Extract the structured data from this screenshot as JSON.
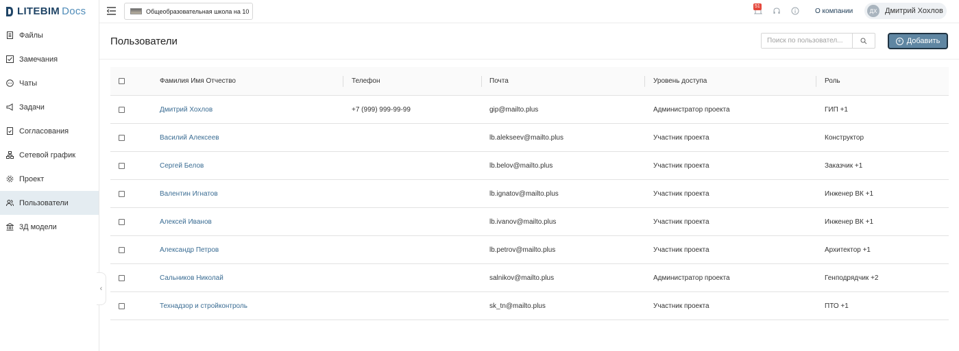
{
  "app": {
    "logo_main": "LITEBIM",
    "logo_sub": "Docs"
  },
  "sidebar": {
    "items": [
      {
        "label": "Файлы",
        "icon": "file-icon"
      },
      {
        "label": "Замечания",
        "icon": "checkbox-icon"
      },
      {
        "label": "Чаты",
        "icon": "chat-icon"
      },
      {
        "label": "Задачи",
        "icon": "megaphone-icon"
      },
      {
        "label": "Согласования",
        "icon": "document-approve-icon"
      },
      {
        "label": "Сетевой график",
        "icon": "network-graph-icon"
      },
      {
        "label": "Проект",
        "icon": "gear-icon"
      },
      {
        "label": "Пользователи",
        "icon": "users-icon"
      },
      {
        "label": "3Д модели",
        "icon": "building-icon"
      }
    ],
    "active_index": 7
  },
  "topbar": {
    "project_name": "Общеобразовательная школа на 10",
    "notifications_count": "51",
    "about_label": "О компании",
    "user_initials": "ДХ",
    "user_name": "Дмитрий Хохлов"
  },
  "header": {
    "title": "Пользователи",
    "search_placeholder": "Поиск по пользовател...",
    "add_label": "Добавить"
  },
  "table": {
    "columns": [
      "Фамилия Имя Отчество",
      "Телефон",
      "Почта",
      "Уровень доступа",
      "Роль"
    ],
    "rows": [
      {
        "name": "Дмитрий Хохлов",
        "phone": "+7 (999) 999-99-99",
        "email": "gip@mailto.plus",
        "access": "Администратор проекта",
        "role": "ГИП +1"
      },
      {
        "name": "Василий Алексеев",
        "phone": "",
        "email": "lb.alekseev@mailto.plus",
        "access": "Участник проекта",
        "role": "Конструктор"
      },
      {
        "name": "Сергей Белов",
        "phone": "",
        "email": "lb.belov@mailto.plus",
        "access": "Участник проекта",
        "role": "Заказчик +1"
      },
      {
        "name": "Валентин Игнатов",
        "phone": "",
        "email": "lb.ignatov@mailto.plus",
        "access": "Участник проекта",
        "role": "Инженер ВК +1"
      },
      {
        "name": "Алексей Иванов",
        "phone": "",
        "email": "lb.ivanov@mailto.plus",
        "access": "Участник проекта",
        "role": "Инженер ВК +1"
      },
      {
        "name": "Александр Петров",
        "phone": "",
        "email": "lb.petrov@mailto.plus",
        "access": "Участник проекта",
        "role": "Архитектор +1"
      },
      {
        "name": "Сальников Николай",
        "phone": "",
        "email": "salnikov@mailto.plus",
        "access": "Администратор проекта",
        "role": "Генподрядчик +2"
      },
      {
        "name": "Технадзор и стройконтроль",
        "phone": "",
        "email": "sk_tn@mailto.plus",
        "access": "Участник проекта",
        "role": "ПТО +1"
      }
    ]
  },
  "colors": {
    "accent": "#5f86a2",
    "link": "#3a6c93",
    "active_bg": "#e4ecf1",
    "badge": "#e5483c"
  }
}
